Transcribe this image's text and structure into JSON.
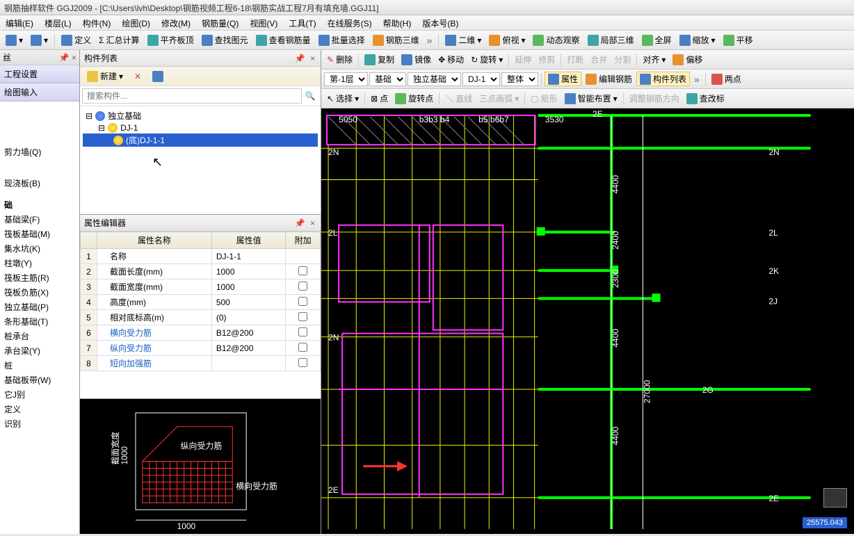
{
  "title": "钢筋抽样软件 GGJ2009 - [C:\\Users\\lvh\\Desktop\\钢筋视频工程6-18\\钢筋实战工程7月有填充墙.GGJ11]",
  "menu": [
    "编辑(E)",
    "楼层(L)",
    "构件(N)",
    "绘图(D)",
    "修改(M)",
    "钢筋量(Q)",
    "视图(V)",
    "工具(T)",
    "在线服务(S)",
    "帮助(H)",
    "版本号(B)"
  ],
  "toolbar1": {
    "define": "定义",
    "sum": "汇总计算",
    "level": "平齐板顶",
    "find": "查找图元",
    "rebar": "查看钢筋量",
    "batch": "批量选择",
    "rebar3d": "钢筋三维",
    "v2d": "二维",
    "top": "俯视",
    "dyn": "动态观察",
    "local3d": "局部三维",
    "full": "全屏",
    "zoom": "缩放",
    "pan": "平移"
  },
  "left": {
    "head": "丝",
    "blocks": [
      "工程设置",
      "绘图输入"
    ],
    "tree": [
      "剪力墙(Q)",
      "现浇板(B)"
    ],
    "tree2head": "础",
    "tree2": [
      "基础梁(F)",
      "筏板基础(M)",
      "集水坑(K)",
      "柱墩(Y)",
      "筏板主筋(R)",
      "筏板负筋(X)",
      "独立基础(P)",
      "条形基础(T)",
      "桩承台",
      "承台梁(Y)",
      "桩",
      "基础板带(W)",
      "它J别",
      "定义",
      "识别"
    ]
  },
  "mid": {
    "panelTitle": "构件列表",
    "newBtn": "新建",
    "searchPH": "搜索构件...",
    "tree": {
      "root": "独立基础",
      "child": "DJ-1",
      "leaf": "(底)DJ-1-1"
    },
    "propTitle": "属性编辑器",
    "cols": [
      "属性名称",
      "属性值",
      "附加"
    ],
    "rows": [
      {
        "n": "1",
        "name": "名称",
        "val": "DJ-1-1",
        "link": false
      },
      {
        "n": "2",
        "name": "截面长度(mm)",
        "val": "1000",
        "link": false
      },
      {
        "n": "3",
        "name": "截面宽度(mm)",
        "val": "1000",
        "link": false
      },
      {
        "n": "4",
        "name": "高度(mm)",
        "val": "500",
        "link": false
      },
      {
        "n": "5",
        "name": "相对底标高(m)",
        "val": "(0)",
        "link": false
      },
      {
        "n": "6",
        "name": "横向受力筋",
        "val": "B12@200",
        "link": true
      },
      {
        "n": "7",
        "name": "纵向受力筋",
        "val": "B12@200",
        "link": true
      },
      {
        "n": "8",
        "name": "短向加强筋",
        "val": "",
        "link": true
      }
    ],
    "preview": {
      "vlabel": "截面宽度",
      "vval": "1000",
      "hlabel1": "纵向受力筋",
      "hlabel2": "横向受力筋",
      "hval": "1000"
    }
  },
  "right": {
    "tb2": {
      "del": "删除",
      "copy": "复制",
      "mirror": "镜像",
      "move": "移动",
      "rotate": "旋转",
      "extend": "延伸",
      "trim": "修剪",
      "break": "打断",
      "merge": "合并",
      "split": "分割",
      "align": "对齐",
      "offset": "偏移"
    },
    "tb3": {
      "floor": "第-1层",
      "cat": "基础",
      "type": "独立基础",
      "inst": "DJ-1",
      "whole": "整体",
      "prop": "属性",
      "editr": "编辑钢筋",
      "list": "构件列表",
      "twop": "两点"
    },
    "tb4": {
      "sel": "选择",
      "pt": "点",
      "rp": "旋转点",
      "line": "直线",
      "arc": "三点画弧",
      "rect": "矩形",
      "smart": "智能布置",
      "adjdir": "调整钢筋方向",
      "chklbl": "查改标"
    },
    "dims": {
      "t1": "5050",
      "t2": "3530",
      "r": [
        "4400",
        "2400",
        "2300",
        "4400",
        "4400"
      ],
      "rsum": "27000",
      "lbl": [
        "2E",
        "2N",
        "2L",
        "2K",
        "2J",
        "2G",
        "2E",
        "2N",
        "2E"
      ]
    },
    "coord": "25575.043"
  }
}
